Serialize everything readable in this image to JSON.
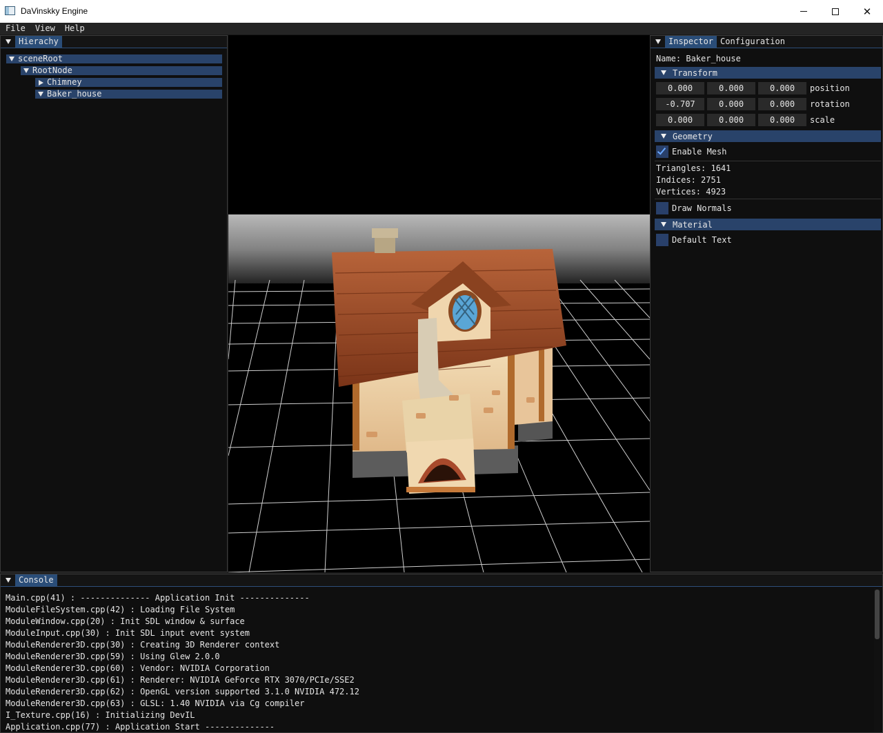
{
  "window": {
    "title": "DaVinskky Engine"
  },
  "menubar": {
    "items": [
      "File",
      "View",
      "Help"
    ]
  },
  "hierarchy": {
    "tab": "Hierachy",
    "nodes": [
      {
        "label": "sceneRoot",
        "expanded": true
      },
      {
        "label": "RootNode",
        "expanded": true
      },
      {
        "label": "Chimney",
        "expanded": false
      },
      {
        "label": "Baker_house",
        "expanded": true
      }
    ]
  },
  "inspector": {
    "tabs": [
      "Inspector",
      "Configuration"
    ],
    "name_line": "Name: Baker_house",
    "transform": {
      "header": "Transform",
      "rows": [
        {
          "label": "position",
          "values": [
            "0.000",
            "0.000",
            "0.000"
          ]
        },
        {
          "label": "rotation",
          "values": [
            "-0.707",
            "0.000",
            "0.000"
          ]
        },
        {
          "label": "scale",
          "values": [
            "0.000",
            "0.000",
            "0.000"
          ]
        }
      ]
    },
    "geometry": {
      "header": "Geometry",
      "enable_mesh_label": "Enable Mesh",
      "enable_mesh_checked": true,
      "triangles": "Triangles: 1641",
      "indices": "Indices: 2751",
      "vertices": "Vertices: 4923",
      "draw_normals_label": "Draw Normals",
      "draw_normals_checked": false
    },
    "material": {
      "header": "Material",
      "default_text_label": "Default Text",
      "default_text_checked": false
    }
  },
  "console": {
    "tab": "Console",
    "lines": [
      "Main.cpp(41) : -------------- Application Init --------------",
      "ModuleFileSystem.cpp(42) : Loading File System",
      "ModuleWindow.cpp(20) : Init SDL window & surface",
      "ModuleInput.cpp(30) : Init SDL input event system",
      "ModuleRenderer3D.cpp(30) : Creating 3D Renderer context",
      "ModuleRenderer3D.cpp(59) : Using Glew 2.0.0",
      "ModuleRenderer3D.cpp(60) : Vendor: NVIDIA Corporation",
      "ModuleRenderer3D.cpp(61) : Renderer: NVIDIA GeForce RTX 3070/PCIe/SSE2",
      "ModuleRenderer3D.cpp(62) : OpenGL version supported 3.1.0 NVIDIA 472.12",
      "ModuleRenderer3D.cpp(63) : GLSL: 1.40 NVIDIA via Cg compiler",
      "I_Texture.cpp(16) : Initializing DevIL",
      "Application.cpp(77) : Application Start --------------"
    ]
  },
  "colors": {
    "accent": "#29436a",
    "tab_active": "#2a4d78",
    "background": "#0f0f0f"
  }
}
